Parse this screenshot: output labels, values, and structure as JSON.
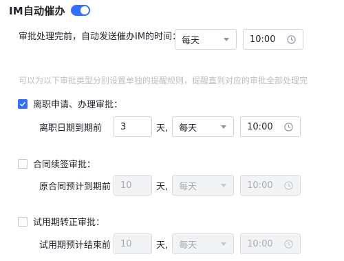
{
  "header": {
    "title": "IM自动催办",
    "toggle_on": true
  },
  "auto_rule": {
    "label": "审批处理完前，自动发送催办IM的时间：",
    "frequency": "每天",
    "time": "10:00"
  },
  "hint": "可以为以下审批类型分别设置单独的提醒规则，提醒直到对应的审批全部处理完",
  "sections": [
    {
      "checked": true,
      "title": "离职申请、办理审批：",
      "row_label": "离职日期到期前",
      "days": "3",
      "unit": "天,",
      "frequency": "每天",
      "time": "10:00",
      "disabled": false
    },
    {
      "checked": false,
      "title": "合同续签审批：",
      "row_label": "原合同预计到期前",
      "days": "10",
      "unit": "天,",
      "frequency": "每天",
      "time": "10:00",
      "disabled": true
    },
    {
      "checked": false,
      "title": "试用期转正审批：",
      "row_label": "试用期预计结束前",
      "days": "10",
      "unit": "天,",
      "frequency": "每天",
      "time": "10:00",
      "disabled": true
    }
  ],
  "colors": {
    "accent": "#3370ff",
    "hint": "#bbbfc4",
    "disabled_bg": "#f2f3f5"
  },
  "icons": {
    "caret": "chevron-down-icon",
    "clock": "clock-icon",
    "check": "check-icon"
  }
}
